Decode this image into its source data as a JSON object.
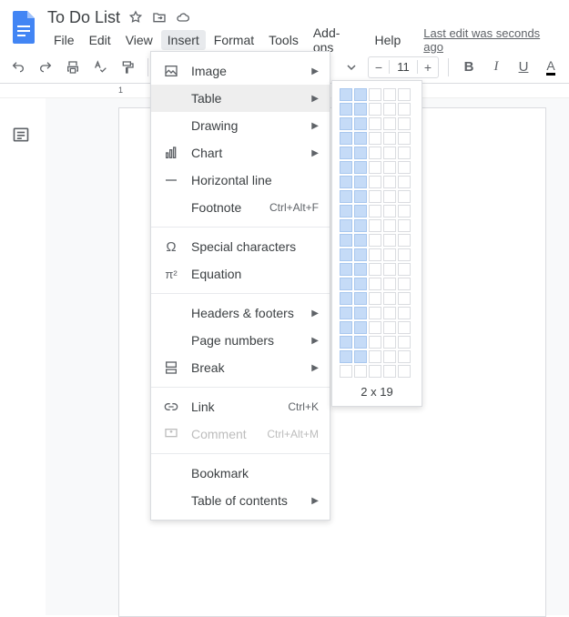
{
  "doc": {
    "title": "To Do List"
  },
  "menubar": {
    "file": "File",
    "edit": "Edit",
    "view": "View",
    "insert": "Insert",
    "format": "Format",
    "tools": "Tools",
    "addons": "Add-ons",
    "help": "Help",
    "last_edit": "Last edit was seconds ago"
  },
  "toolbar": {
    "font_size": "11"
  },
  "ruler": {
    "mark1": "1"
  },
  "dropdown": {
    "image": "Image",
    "table": "Table",
    "drawing": "Drawing",
    "chart": "Chart",
    "horizontal_line": "Horizontal line",
    "footnote": "Footnote",
    "footnote_shortcut": "Ctrl+Alt+F",
    "special_chars": "Special characters",
    "equation": "Equation",
    "headers_footers": "Headers & footers",
    "page_numbers": "Page numbers",
    "break": "Break",
    "link": "Link",
    "link_shortcut": "Ctrl+K",
    "comment": "Comment",
    "comment_shortcut": "Ctrl+Alt+M",
    "bookmark": "Bookmark",
    "toc": "Table of contents"
  },
  "table_picker": {
    "cols": 5,
    "rows": 20,
    "sel_cols": 2,
    "sel_rows": 19,
    "label": "2 x 19"
  }
}
